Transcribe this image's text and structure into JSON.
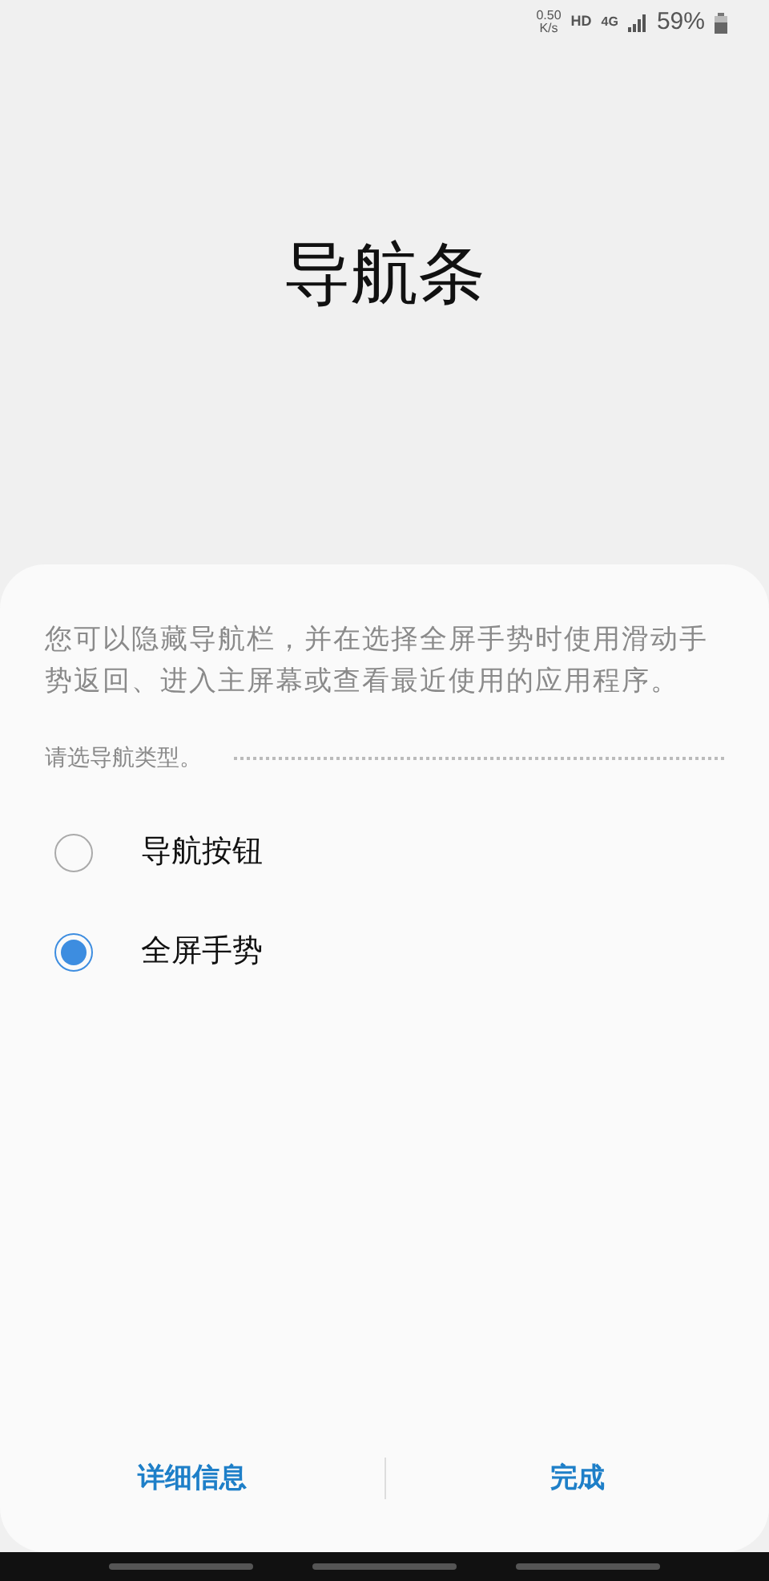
{
  "status_bar": {
    "speed_value": "0.50",
    "speed_unit": "K/s",
    "hd": "HD",
    "network": "4G",
    "battery": "59%"
  },
  "title": "导航条",
  "sheet": {
    "description": "您可以隐藏导航栏，并在选择全屏手势时使用滑动手势返回、进入主屏幕或查看最近使用的应用程序。",
    "section_label": "请选导航类型。",
    "options": [
      {
        "label": "导航按钮",
        "selected": false
      },
      {
        "label": "全屏手势",
        "selected": true
      }
    ],
    "buttons": [
      "详细信息",
      "完成"
    ]
  }
}
